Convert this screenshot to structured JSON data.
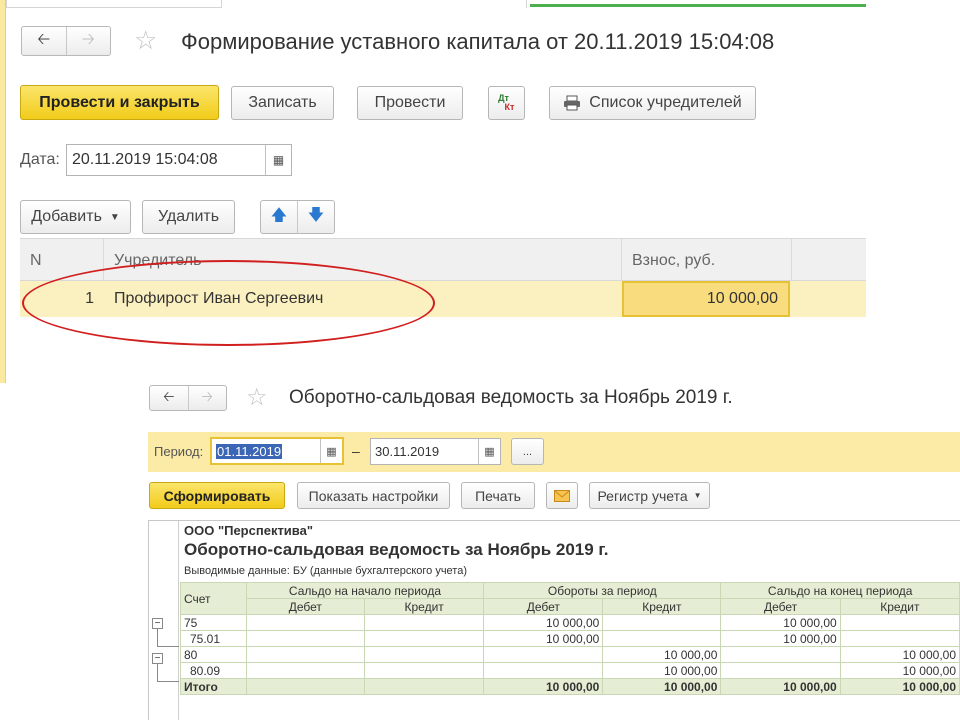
{
  "doc": {
    "title": "Формирование уставного капитала от 20.11.2019 15:04:08",
    "buttons": {
      "post_close": "Провести и закрыть",
      "save": "Записать",
      "post": "Провести",
      "dtkt_top": "Дт",
      "dtkt_bottom": "Кт",
      "founders_list": "Список учредителей"
    },
    "date_label": "Дата:",
    "date_value": "20.11.2019 15:04:08",
    "table_buttons": {
      "add": "Добавить",
      "delete": "Удалить"
    },
    "columns": {
      "n": "N",
      "founder": "Учредитель",
      "contribution": "Взнос, руб."
    },
    "rows": [
      {
        "n": "1",
        "founder": "Профирост Иван Сергеевич",
        "contribution": "10 000,00"
      }
    ]
  },
  "report": {
    "title": "Оборотно-сальдовая ведомость за Ноябрь 2019 г.",
    "period_label": "Период:",
    "period_from": "01.11.2019",
    "period_dash": "–",
    "period_to": "30.11.2019",
    "period_more": "...",
    "buttons": {
      "generate": "Сформировать",
      "show_settings": "Показать настройки",
      "print": "Печать",
      "register": "Регистр учета"
    },
    "org": "ООО \"Перспектива\"",
    "heading": "Оборотно-сальдовая ведомость за Ноябрь 2019 г.",
    "output_data": "Выводимые данные:  БУ (данные бухгалтерского учета)",
    "col_account": "Счет",
    "groups": {
      "opening": "Сальдо на начало периода",
      "turnover": "Обороты за период",
      "closing": "Сальдо на конец периода"
    },
    "debit": "Дебет",
    "credit": "Кредит",
    "rows": [
      {
        "account": "75",
        "ob_dt": "10 000,00",
        "ob_kt": "",
        "end_dt": "10 000,00",
        "end_kt": ""
      },
      {
        "account": "75.01",
        "ob_dt": "10 000,00",
        "ob_kt": "",
        "end_dt": "10 000,00",
        "end_kt": ""
      },
      {
        "account": "80",
        "ob_dt": "",
        "ob_kt": "10 000,00",
        "end_dt": "",
        "end_kt": "10 000,00"
      },
      {
        "account": "80.09",
        "ob_dt": "",
        "ob_kt": "10 000,00",
        "end_dt": "",
        "end_kt": "10 000,00"
      }
    ],
    "total": {
      "label": "Итого",
      "ob_dt": "10 000,00",
      "ob_kt": "10 000,00",
      "end_dt": "10 000,00",
      "end_kt": "10 000,00"
    }
  }
}
